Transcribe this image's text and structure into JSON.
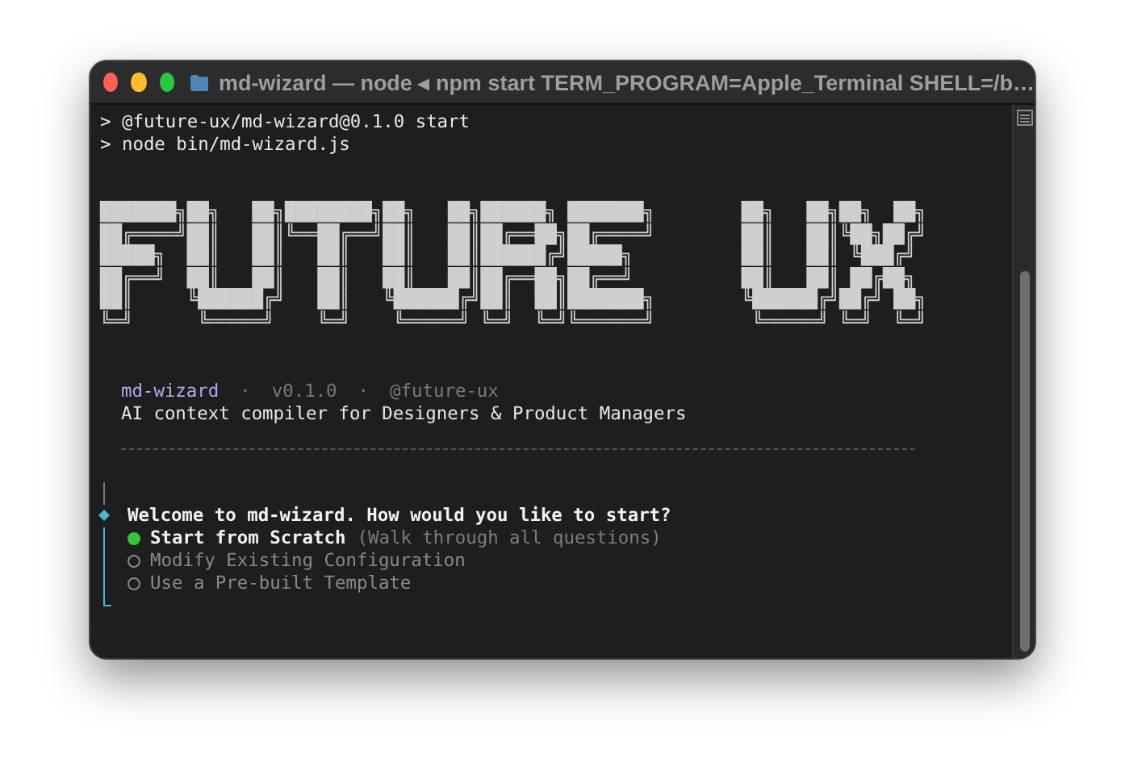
{
  "window": {
    "title": "md-wizard — node ◂ npm start TERM_PROGRAM=Apple_Terminal SHELL=/b…"
  },
  "terminal": {
    "command_lines": [
      "> @future-ux/md-wizard@0.1.0 start",
      "> node bin/md-wizard.js"
    ],
    "banner": {
      "lines": [
        "███████╗██╗   ██╗████████╗██╗   ██╗██████╗ ███████╗        ██╗   ██╗██╗  ██╗",
        "██╔════╝██║   ██║╚══██╔══╝██║   ██║██╔══██╗██╔════╝        ██║   ██║╚██╗██╔╝",
        "█████╗  ██║   ██║   ██║   ██║   ██║██████╔╝█████╗          ██║   ██║ ╚███╔╝ ",
        "██╔══╝  ██║   ██║   ██║   ██║   ██║██╔══██╗██╔══╝          ██║   ██║ ██╔██╗ ",
        "██║     ╚██████╔╝   ██║   ╚██████╔╝██║  ██║███████╗        ╚██████╔╝██╔╝ ██╗",
        "╚═╝      ╚═════╝    ╚═╝    ╚═════╝ ╚═╝  ╚═╝╚══════╝         ╚═════╝ ╚═╝  ╚═╝"
      ]
    },
    "meta": {
      "name": "md-wizard",
      "separator_1": "·",
      "version": "v0.1.0",
      "separator_2": "·",
      "scope": "@future-ux",
      "tagline": "AI context compiler for Designers & Product Managers"
    },
    "prompt": {
      "question": "Welcome to md-wizard. How would you like to start?",
      "options": [
        {
          "label": "Start from Scratch",
          "hint": "(Walk through all questions)",
          "selected": true
        },
        {
          "label": "Modify Existing Configuration",
          "selected": false
        },
        {
          "label": "Use a Pre-built Template",
          "selected": false
        }
      ]
    }
  }
}
